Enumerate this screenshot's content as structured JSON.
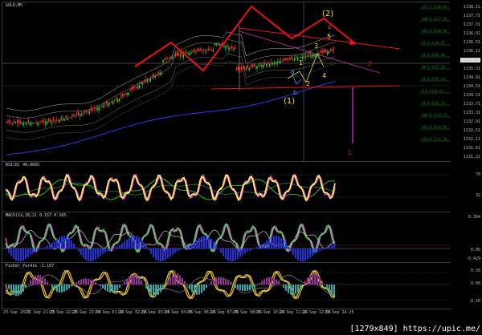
{
  "chart_title": "GOLD,M5",
  "price_axis": [
    "1138.11",
    "1137.71",
    "1137.31",
    "1136.91",
    "1136.51",
    "1136.11",
    "1135.71",
    "1135.31",
    "1134.91",
    "1134.51",
    "1134.11",
    "1133.71",
    "1133.31",
    "1132.91",
    "1132.51",
    "1132.11",
    "1131.61",
    "1131.21"
  ],
  "current_price": "1136.06",
  "fib_labels": [
    "127.2  1138.16",
    "100.0  1137.42",
    "161.8  1136.96",
    "61.8  1136.42",
    "50.0  1136.06",
    "38.2  1135.56",
    "23.6  1135.24",
    "0.0  1134.43",
    "61.8  1134.13",
    "100.0  1133.21",
    "161.8  1132.58",
    "261.8  1131.56"
  ],
  "wave_labels": {
    "w2": "(2)",
    "c": "c",
    "w5": "5",
    "w3": "3",
    "w1": "1",
    "w4": "4",
    "w2b": "2",
    "a": "a",
    "b": "b",
    "w1b": "(1)",
    "red1": "1",
    "red2": "2"
  },
  "rsi": {
    "label": "RSI(8) 46.0665",
    "axis": [
      "70",
      "32"
    ]
  },
  "macd": {
    "label": "MACD(12,26,2) 0.157 0.165",
    "axis": [
      "0.384",
      "0.00",
      "-0.429"
    ]
  },
  "fisher": {
    "label": "Fisher_Yur4ik -1.107",
    "axis": [
      "0.56",
      "0.00",
      "-0.56"
    ]
  },
  "time_labels": [
    "23 Sep 2015",
    "23 Sep 21:15",
    "23 Sep 22:25",
    "23 Sep 23:55",
    "24 Sep 01:25",
    "24 Sep 02:55",
    "24 Sep 03:55",
    "24 Sep 04:55",
    "24 Sep 06:25",
    "24 Sep 07:35",
    "24 Sep 08:55",
    "24 Sep 10:25",
    "24 Sep 11:25",
    "24 Sep 12:55",
    "24 Sep 14:25"
  ],
  "credit": "[1279x849] https://upic.me/",
  "colors": {
    "bull": "#33cc33",
    "bear": "#ff3333",
    "trend": "#ee1111",
    "wave_yellow": "#ffdd33",
    "wave_blue": "#3399ff",
    "fib": "#228822",
    "ma_blue": "#2244ff"
  }
}
